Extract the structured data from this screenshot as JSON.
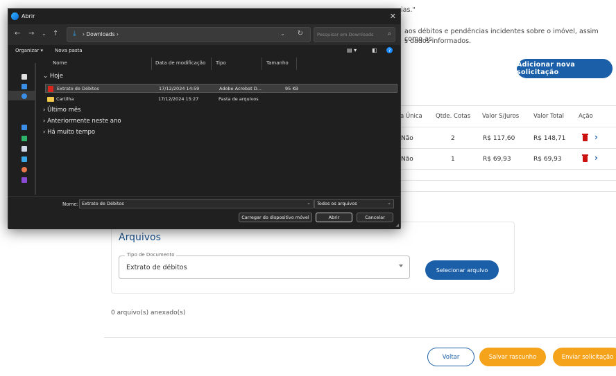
{
  "web": {
    "fragment1": "ias.\"",
    "fragment2": "aos débitos e pendências incidentes sobre o imóvel, assim como as",
    "fragment3": "s dados informados.",
    "add_button": "Adicionar nova solicitação",
    "table": {
      "headers": [
        "a Única",
        "Qtde. Cotas",
        "Valor S/Juros",
        "Valor Total",
        "Ação"
      ],
      "rows": [
        {
          "unica": "Não",
          "cotas": "2",
          "valor": "R$ 117,60",
          "total": "R$ 148,71"
        },
        {
          "unica": "Não",
          "cotas": "1",
          "valor": "R$ 69,93",
          "total": "R$ 69,93"
        }
      ]
    },
    "arquivos": {
      "title": "Arquivos",
      "doc_type_label": "Tipo de Documento",
      "doc_type_value": "Extrato de débitos",
      "select_button": "Selecionar arquivo",
      "attached_count": "0 arquivo(s) anexado(s)"
    },
    "footer": {
      "voltar": "Voltar",
      "salvar": "Salvar rascunho",
      "enviar": "Enviar solicitação"
    }
  },
  "dialog": {
    "title": "Abrir",
    "address": "Downloads",
    "search_placeholder": "Pesquisar em Downloads",
    "toolbar": {
      "organize": "Organizar",
      "new_folder": "Nova pasta"
    },
    "columns": [
      "Nome",
      "Data de modificação",
      "Tipo",
      "Tamanho"
    ],
    "groups": [
      "Hoje",
      "Último mês",
      "Anteriormente neste ano",
      "Há muito tempo"
    ],
    "files": [
      {
        "name": "Extrato de Débitos",
        "date": "17/12/2024 14:59",
        "type": "Adobe Acrobat D...",
        "size": "95 KB"
      },
      {
        "name": "Cartilha",
        "date": "17/12/2024 15:27",
        "type": "Pasta de arquivos",
        "size": ""
      }
    ],
    "filename_label": "Nome:",
    "filename_value": "Extrato de Débitos",
    "filetype_value": "Todos os arquivos",
    "buttons": {
      "upload": "Carregar do dispositivo móvel",
      "open": "Abrir",
      "cancel": "Cancelar"
    }
  },
  "colors": {
    "primary": "#1a5fa8",
    "accent": "#f5a31a",
    "danger": "#cc1111"
  }
}
